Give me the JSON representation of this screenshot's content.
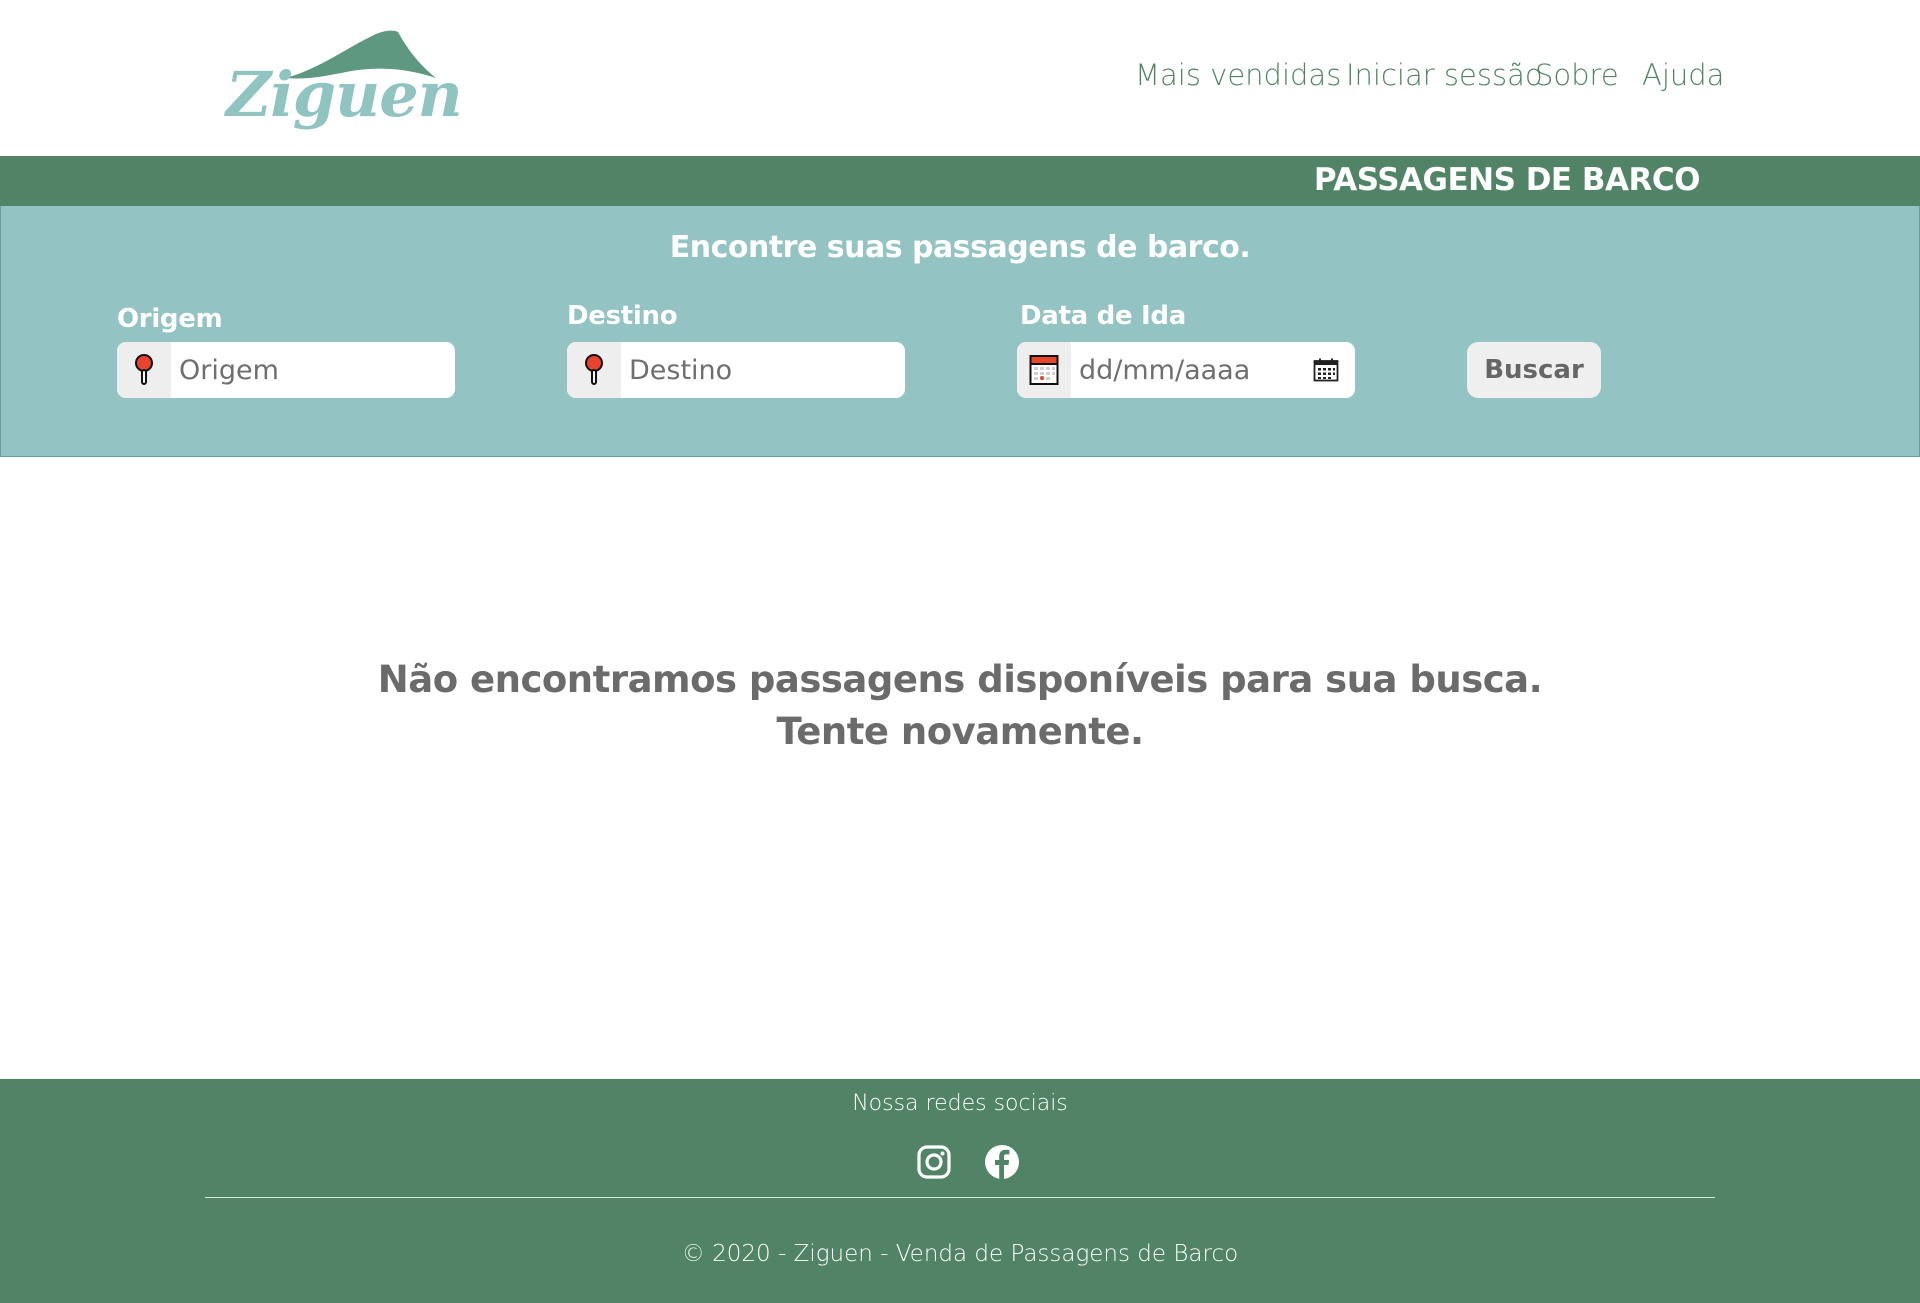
{
  "header": {
    "logo_text": "Ziguen",
    "nav": [
      "Mais vendidas",
      "Iniciar sessão",
      "Sobre",
      "Ajuda"
    ]
  },
  "banner": {
    "title": "PASSAGENS DE BARCO"
  },
  "search": {
    "heading": "Encontre suas passagens de barco.",
    "origem": {
      "label": "Origem",
      "placeholder": "Origem",
      "icon": "map-pin-icon"
    },
    "destino": {
      "label": "Destino",
      "placeholder": "Destino",
      "icon": "map-pin-icon"
    },
    "data_ida": {
      "label": "Data de Ida",
      "placeholder": "dd/mm/aaaa",
      "icon": "calendar-icon"
    },
    "button_label": "Buscar"
  },
  "results": {
    "line1": "Não encontramos passagens disponíveis para sua busca.",
    "line2": "Tente novamente."
  },
  "footer": {
    "social_title": "Nossa redes sociais",
    "social_icons": [
      "instagram-icon",
      "facebook-icon"
    ],
    "copyright": "© 2020 - Ziguen - Venda de Passagens de Barco"
  },
  "colors": {
    "primary_green": "#518466",
    "search_panel": "#93c3c3",
    "logo_teal": "#8fc4c1",
    "message_gray": "#6b6b6b"
  }
}
